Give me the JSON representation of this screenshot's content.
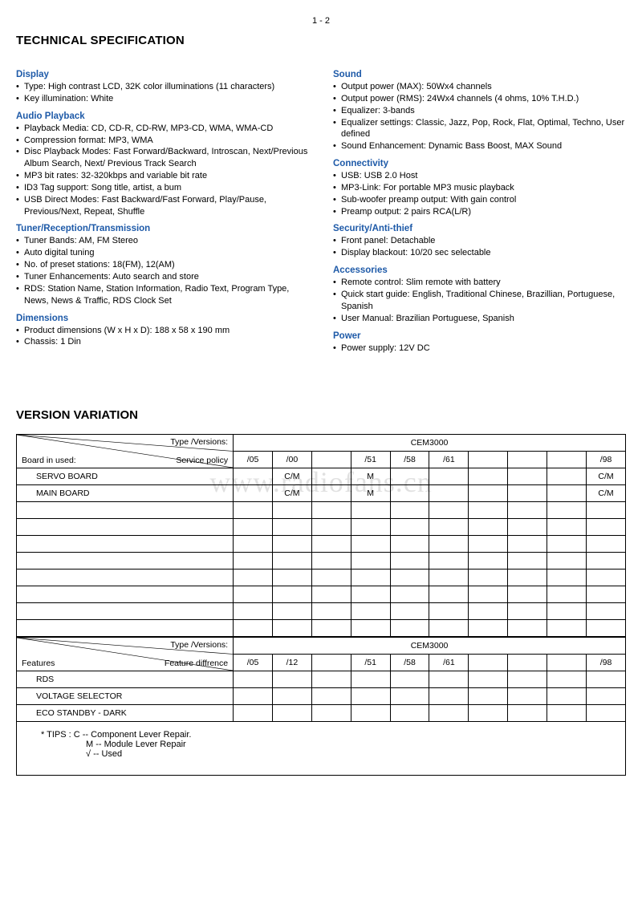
{
  "page_number": "1 - 2",
  "heading_spec": "TECHNICAL SPECIFICATION",
  "watermark": "www.radiofans.cn",
  "heading_version": "VERSION VARIATION",
  "left_sections": [
    {
      "title": "Display",
      "items": [
        "Type: High contrast LCD, 32K color illuminations (11 characters)",
        "Key illumination: White"
      ]
    },
    {
      "title": "Audio Playback",
      "items": [
        "Playback Media: CD, CD-R, CD-RW, MP3-CD, WMA, WMA-CD",
        "Compression format: MP3, WMA",
        "Disc Playback Modes: Fast Forward/Backward, Introscan, Next/Previous Album Search, Next/ Previous Track Search",
        "MP3 bit rates: 32-320kbps and variable bit rate",
        "ID3 Tag support: Song title, artist, a bum",
        "USB Direct Modes: Fast Backward/Fast Forward, Play/Pause, Previous/Next, Repeat, Shuffle"
      ]
    },
    {
      "title": "Tuner/Reception/Transmission",
      "items": [
        "Tuner Bands: AM, FM Stereo",
        "Auto digital tuning",
        "No. of preset stations: 18(FM), 12(AM)",
        "Tuner Enhancements: Auto search and store",
        "RDS: Station Name, Station Information, Radio Text, Program Type, News, News & Traffic, RDS Clock Set"
      ]
    },
    {
      "title": "Dimensions",
      "items": [
        "Product dimensions (W x H x D): 188 x 58 x 190 mm",
        "Chassis: 1 Din"
      ]
    }
  ],
  "right_sections": [
    {
      "title": "Sound",
      "items": [
        "Output power (MAX): 50Wx4 channels",
        "Output power (RMS): 24Wx4 channels (4 ohms, 10% T.H.D.)",
        "Equalizer: 3-bands",
        "Equalizer settings: Classic, Jazz, Pop, Rock, Flat, Optimal, Techno, User defined",
        "Sound Enhancement: Dynamic Bass Boost, MAX Sound"
      ]
    },
    {
      "title": "Connectivity",
      "items": [
        "USB: USB 2.0 Host",
        "MP3-Link: For portable MP3 music playback",
        "Sub-woofer preamp output: With gain control",
        "Preamp output: 2 pairs RCA(L/R)"
      ]
    },
    {
      "title": "Security/Anti-thief",
      "items": [
        "Front panel: Detachable",
        "Display blackout: 10/20 sec selectable"
      ]
    },
    {
      "title": "Accessories",
      "items": [
        "Remote control: Slim remote with battery",
        "Quick start guide: English, Traditional Chinese, Brazillian, Portuguese, Spanish",
        "User Manual: Brazilian Portuguese, Spanish"
      ]
    },
    {
      "title": "Power",
      "items": [
        "Power supply: 12V DC"
      ]
    }
  ],
  "table1": {
    "diag_top": "Type /Versions:",
    "diag_bl": "Board in used:",
    "diag_br": "Service policy",
    "model_header": "CEM3000",
    "cols": [
      "/05",
      "/00",
      "",
      "/51",
      "/58",
      "/61",
      "",
      "",
      "",
      "/98"
    ],
    "rows": [
      {
        "label": "SERVO BOARD",
        "cells": [
          "",
          "C/M",
          "",
          "M",
          "",
          "",
          "",
          "",
          "",
          "C/M"
        ]
      },
      {
        "label": "MAIN  BOARD",
        "cells": [
          "",
          "C/M",
          "",
          "M",
          "",
          "",
          "",
          "",
          "",
          "C/M"
        ]
      }
    ],
    "blank_rows": 8
  },
  "table2": {
    "diag_top": "Type /Versions:",
    "diag_bl": "Features",
    "diag_br": "Feature diffrence",
    "model_header": "CEM3000",
    "cols": [
      "/05",
      "/12",
      "",
      "/51",
      "/58",
      "/61",
      "",
      "",
      "",
      "/98"
    ],
    "rows": [
      {
        "label": "RDS",
        "cells": [
          "",
          "",
          "",
          "",
          "",
          "",
          "",
          "",
          "",
          ""
        ]
      },
      {
        "label": "VOLTAGE SELECTOR",
        "cells": [
          "",
          "",
          "",
          "",
          "",
          "",
          "",
          "",
          "",
          ""
        ]
      },
      {
        "label": "ECO STANDBY - DARK",
        "cells": [
          "",
          "",
          "",
          "",
          "",
          "",
          "",
          "",
          "",
          ""
        ]
      }
    ]
  },
  "tips": {
    "line1": "* TIPS :  C  -- Component Lever Repair.",
    "line2": "M  -- Module Lever Repair",
    "line3": "√  -- Used"
  }
}
